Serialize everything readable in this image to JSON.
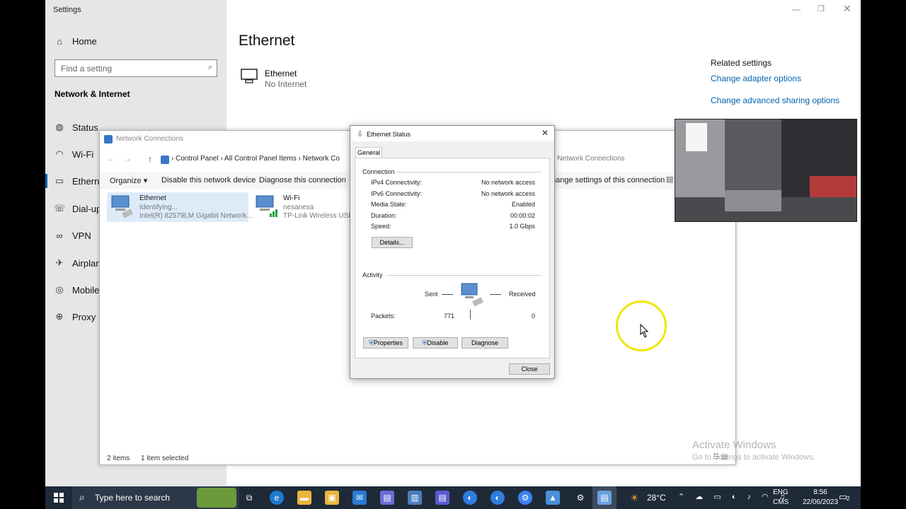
{
  "settings": {
    "title": "Settings",
    "home_label": "Home",
    "search_placeholder": "Find a setting",
    "section_title": "Network & Internet",
    "nav": [
      "Status",
      "Wi-Fi",
      "Ethernet",
      "Dial-up",
      "VPN",
      "Airplane",
      "Mobile",
      "Proxy"
    ],
    "page_title": "Ethernet",
    "ethernet_name": "Ethernet",
    "ethernet_status": "No Internet",
    "related_title": "Related settings",
    "related_links": [
      "Change adapter options",
      "Change advanced sharing options"
    ]
  },
  "network_connections": {
    "title": "Network Connections",
    "breadcrumb": [
      "Control Panel",
      "All Control Panel Items",
      "Network Co"
    ],
    "search_placeholder": "h Network Connections",
    "toolbar": [
      "Organize ▾",
      "Disable this network device",
      "Diagnose this connection",
      "hange settings of this connection"
    ],
    "adapters": [
      {
        "name": "Ethernet",
        "status": "Identifying...",
        "device": "Intel(R) 82579LM Gigabit Network..."
      },
      {
        "name": "Wi-Fi",
        "status": "nesanesa",
        "device": "TP-Link Wireless USB A"
      }
    ],
    "status_items": "2 items",
    "status_selected": "1 item selected"
  },
  "dialog": {
    "title": "Ethernet Status",
    "tab": "General",
    "connection_header": "Connection",
    "rows": [
      {
        "label": "IPv4 Connectivity:",
        "value": "No network access"
      },
      {
        "label": "IPv6 Connectivity:",
        "value": "No network access"
      },
      {
        "label": "Media State:",
        "value": "Enabled"
      },
      {
        "label": "Duration:",
        "value": "00:00:02"
      },
      {
        "label": "Speed:",
        "value": "1.0 Gbps"
      }
    ],
    "details_button": "Details...",
    "activity_header": "Activity",
    "sent_label": "Sent",
    "received_label": "Received",
    "packets_label": "Packets:",
    "packets_sent": "771",
    "packets_received": "0",
    "properties_button": "Properties",
    "disable_button": "Disable",
    "diagnose_button": "Diagnose",
    "close_button": "Close"
  },
  "watermark": {
    "title": "Activate Windows",
    "subtitle": "Go to Settings to activate Windows."
  },
  "taskbar": {
    "search_placeholder": "Type here to search",
    "weather": "28°C",
    "lang1": "ENG",
    "lang2": "CMS",
    "time": "8:56",
    "date": "22/06/2023",
    "notifications": "2"
  },
  "colors": {
    "accent": "#0063b1",
    "cursor_highlight": "#f2e600",
    "taskbar": "#1f2a38"
  }
}
